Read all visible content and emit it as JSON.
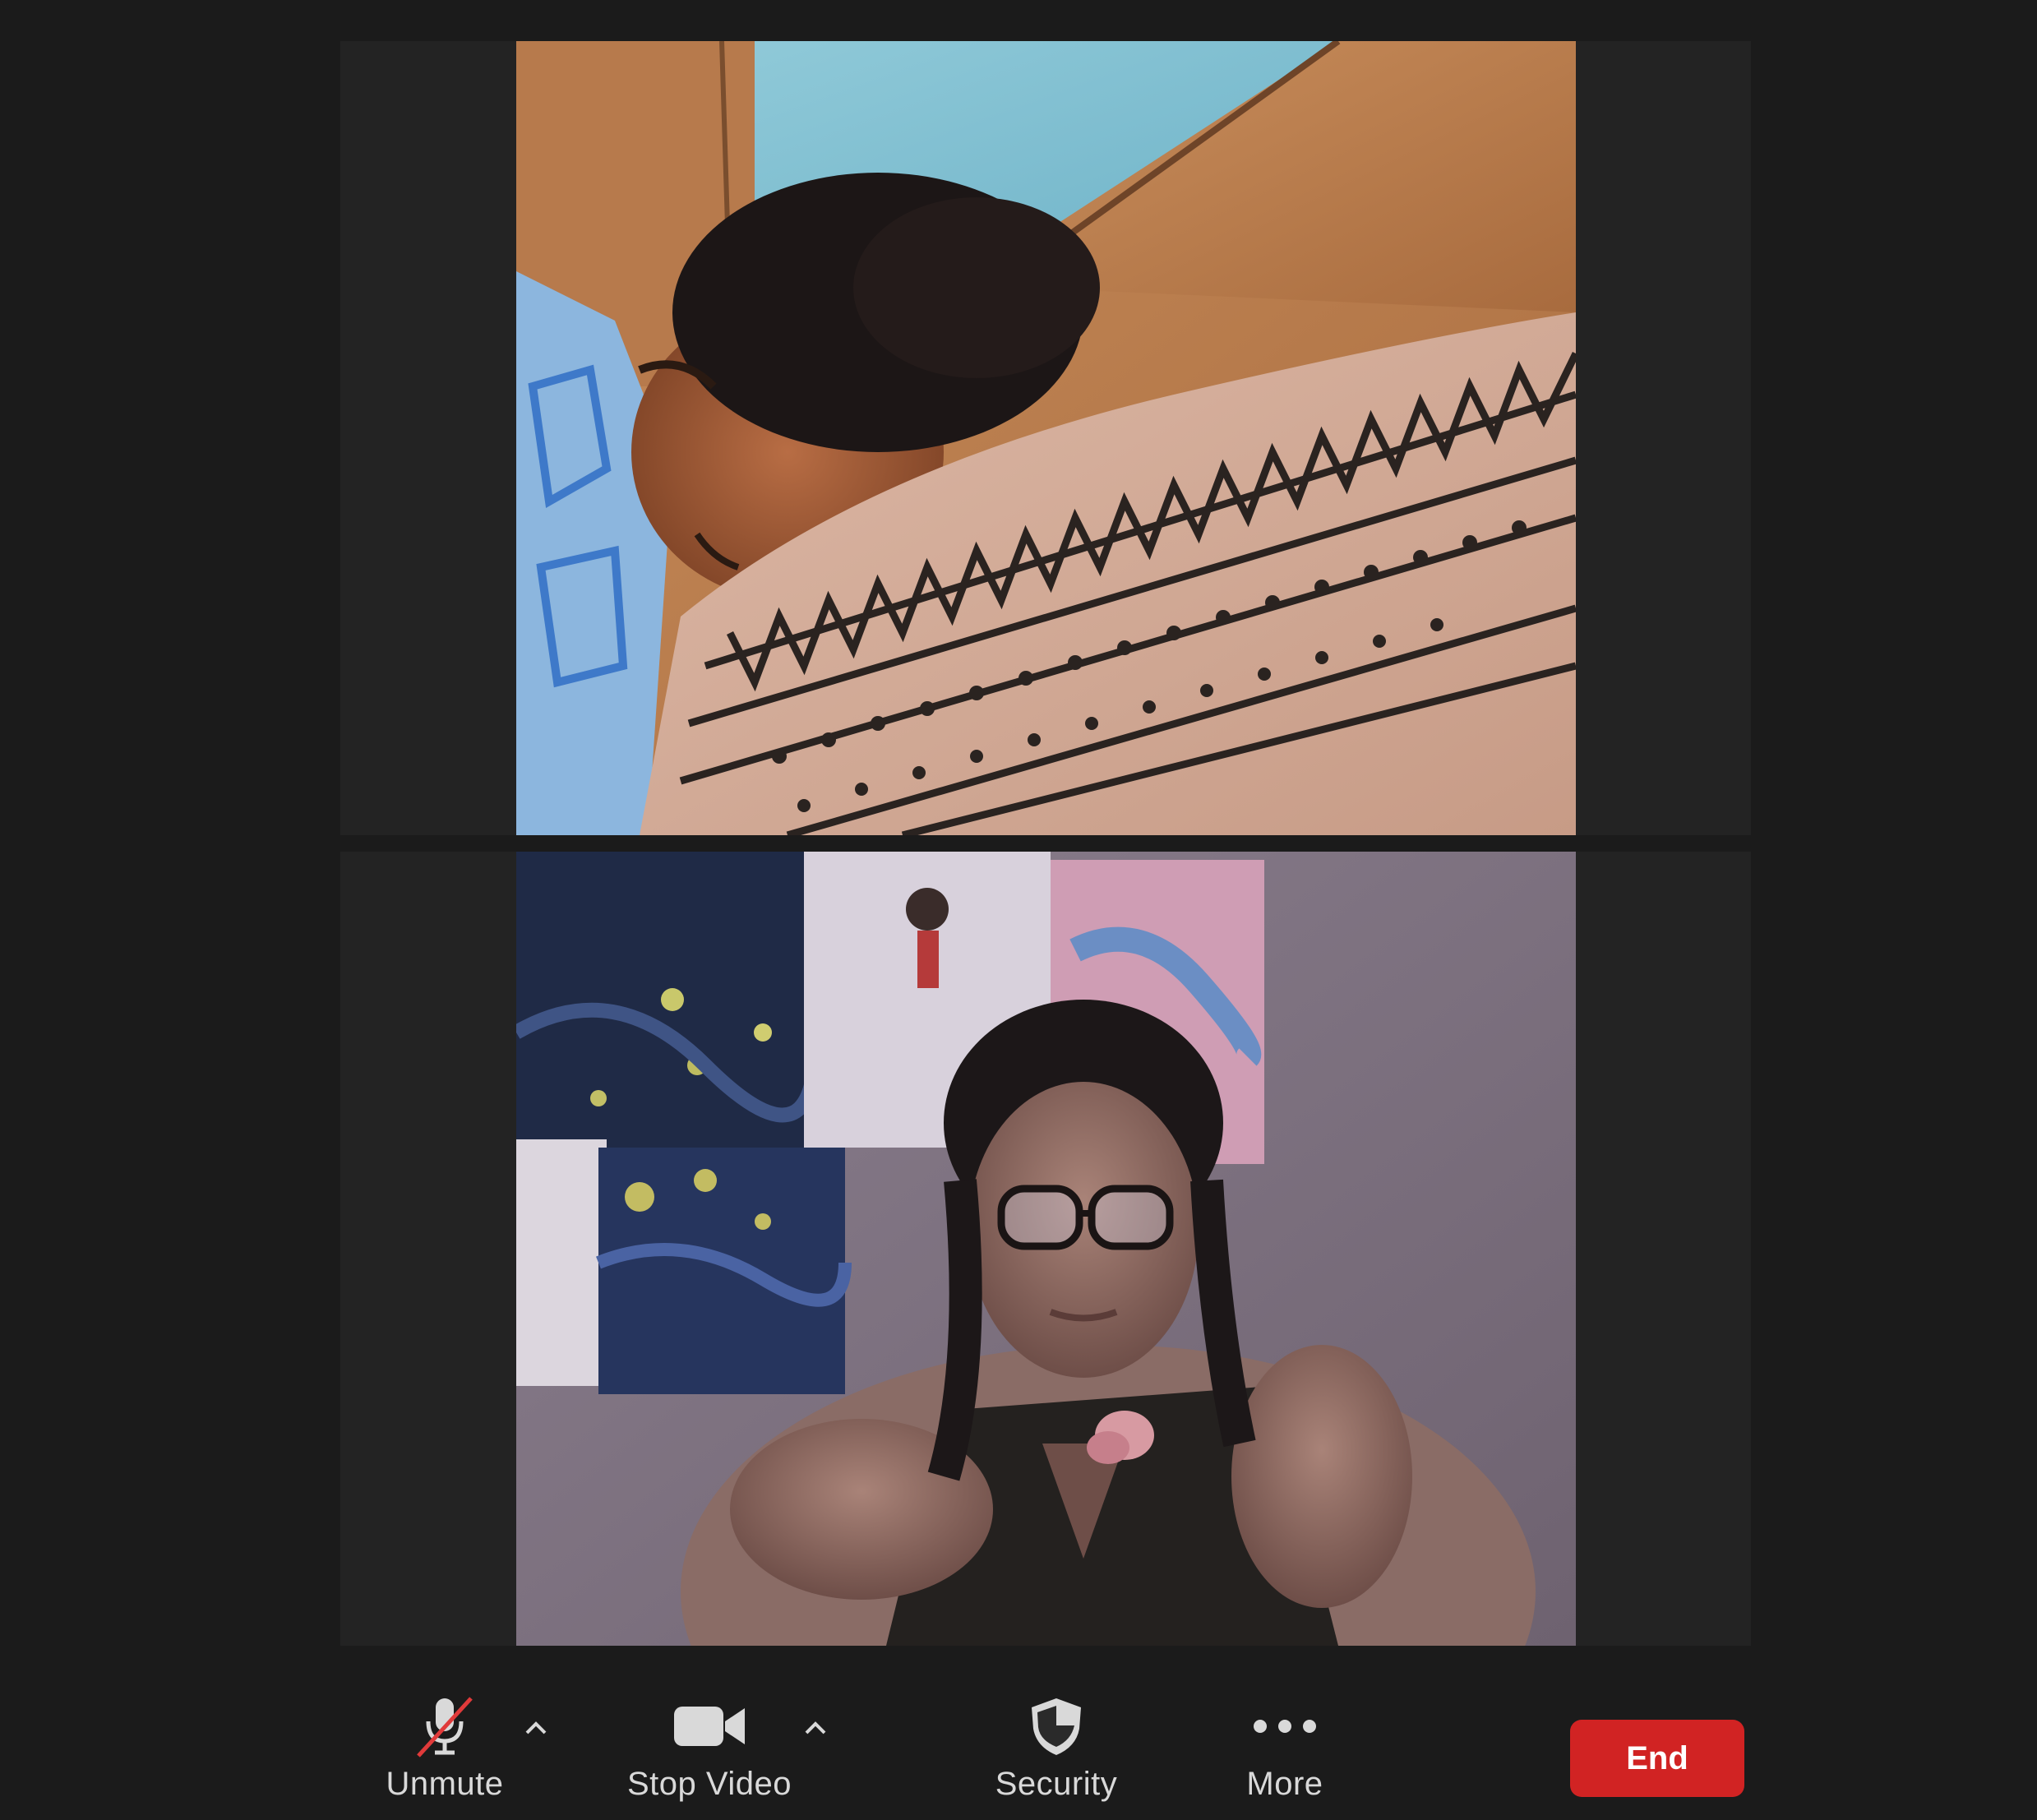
{
  "participants": [
    {
      "tile": "video-tile-1",
      "scene": "person lying on bed"
    },
    {
      "tile": "video-tile-2",
      "scene": "person with glasses in room with posters"
    }
  ],
  "toolbar": {
    "unmute_label": "Unmute",
    "stop_video_label": "Stop Video",
    "security_label": "Security",
    "more_label": "More",
    "end_label": "End"
  },
  "colors": {
    "background": "#1b1b1b",
    "tile_background": "#232323",
    "end_button": "#d12323",
    "muted_slash": "#e03a3a",
    "toolbar_text": "#d9d9d9"
  },
  "icons": {
    "unmute": "microphone-muted-icon",
    "unmute_caret": "caret-up-icon",
    "stop_video": "video-camera-icon",
    "stop_video_caret": "caret-up-icon",
    "security": "shield-icon",
    "more": "ellipsis-icon"
  }
}
